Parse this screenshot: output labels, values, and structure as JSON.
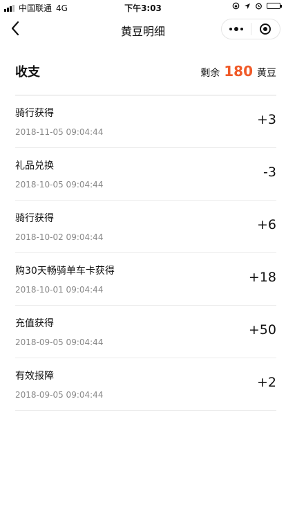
{
  "status_bar": {
    "carrier": "中国联通",
    "network": "4G",
    "time": "下午3:03"
  },
  "nav": {
    "title": "黄豆明细"
  },
  "summary": {
    "title": "收支",
    "remaining_label": "剩余",
    "remaining_amount": "180",
    "unit": "黄豆",
    "accent_color": "#f05a28"
  },
  "records": [
    {
      "title": "骑行获得",
      "time": "2018-11-05 09:04:44",
      "amount": "+3"
    },
    {
      "title": "礼品兑换",
      "time": "2018-10-05 09:04:44",
      "amount": "-3"
    },
    {
      "title": "骑行获得",
      "time": "2018-10-02 09:04:44",
      "amount": "+6"
    },
    {
      "title": "购30天畅骑单车卡获得",
      "time": "2018-10-01 09:04:44",
      "amount": "+18"
    },
    {
      "title": "充值获得",
      "time": "2018-09-05 09:04:44",
      "amount": "+50"
    },
    {
      "title": "有效报障",
      "time": "2018-09-05 09:04:44",
      "amount": "+2"
    }
  ]
}
